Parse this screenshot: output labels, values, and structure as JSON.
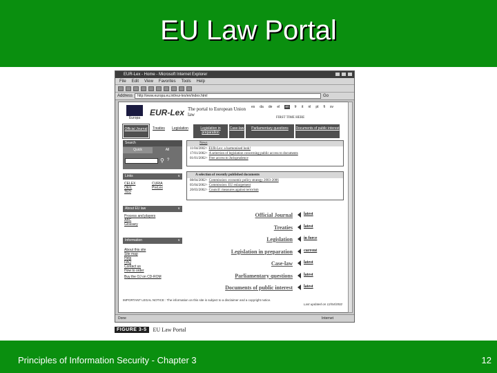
{
  "slide": {
    "title": "EU Law Portal",
    "footer_left": "Principles of Information Security - Chapter 3",
    "page_number": "12",
    "colors": {
      "title_bar": "#0a8f0f",
      "footer_bar": "#0a8f0f"
    }
  },
  "figure": {
    "label": "FIGURE 3-5",
    "caption": "EU Law Portal"
  },
  "browser": {
    "window_title": "EUR-Lex - Home - Microsoft Internet Explorer",
    "menu": [
      "File",
      "Edit",
      "View",
      "Favorites",
      "Tools",
      "Help"
    ],
    "address_label": "Address",
    "address_value": "http://www.europa.eu.int/eur-lex/en/index.html",
    "go_label": "Go",
    "status_left": "Done",
    "status_right": "Internet",
    "page": {
      "logo_caption": "Europa",
      "brand": "EUR-Lex",
      "tagline": "The portal to European Union law",
      "languages": [
        "es",
        "da",
        "de",
        "el",
        "en",
        "fr",
        "it",
        "nl",
        "pt",
        "fi",
        "sv"
      ],
      "first_time": "FIRST TIME HERE",
      "nav": [
        "Official Journal",
        "Treaties",
        "Legislation",
        "Legislation in preparation",
        "Case-law",
        "Parliamentary questions",
        "Documents of public interest"
      ],
      "search": {
        "header": "Search",
        "tab_quick": "Quick",
        "tab_all": "All",
        "help": "?"
      },
      "news": {
        "header": "News",
        "items": [
          {
            "date": "11/04/2002>",
            "text": "EUR-Lex: a harmonised look!"
          },
          {
            "date": "17/01/2002>",
            "text": "A selection of legislation concerning public access to documents"
          },
          {
            "date": "01/01/2002>",
            "text": "Free access to Jurisprudence"
          }
        ]
      },
      "links": {
        "header": "Links",
        "items": [
          "CELEX",
          "CURIA",
          "OEIL",
          "PreLex",
          "TED"
        ]
      },
      "recent_docs": {
        "header": "A selection of recently published documents",
        "items": [
          {
            "date": "08/04/2002>",
            "text": "Commission: economic policy strategy 2003-2006"
          },
          {
            "date": "05/04/2002>",
            "text": "Commission: EU enlargement"
          },
          {
            "date": "20/03/2002>",
            "text": "Council: measures against terrorism"
          }
        ]
      },
      "about": {
        "header": "About EU law",
        "items": [
          "Process and players",
          "ABC",
          "Glossary"
        ]
      },
      "info": {
        "header": "Information",
        "items": [
          "About this site",
          "Site map",
          "Help",
          "FAQ",
          "Contact us",
          "How to order",
          "Buy the OJ on CD-ROM"
        ]
      },
      "categories": [
        {
          "name": "Official Journal",
          "status": "latest"
        },
        {
          "name": "Treaties",
          "status": "latest"
        },
        {
          "name": "Legislation",
          "status": "in force"
        },
        {
          "name": "Legislation in preparation",
          "status": "current"
        },
        {
          "name": "Case-law",
          "status": "latest"
        },
        {
          "name": "Parliamentary questions",
          "status": "latest"
        },
        {
          "name": "Documents of public interest",
          "status": "latest"
        }
      ],
      "legal_notice": "IMPORTANT LEGAL NOTICE : The information on this site is subject to a disclaimer and a copyright notice.",
      "last_updated": "Last updated on 12/04/2002"
    }
  }
}
